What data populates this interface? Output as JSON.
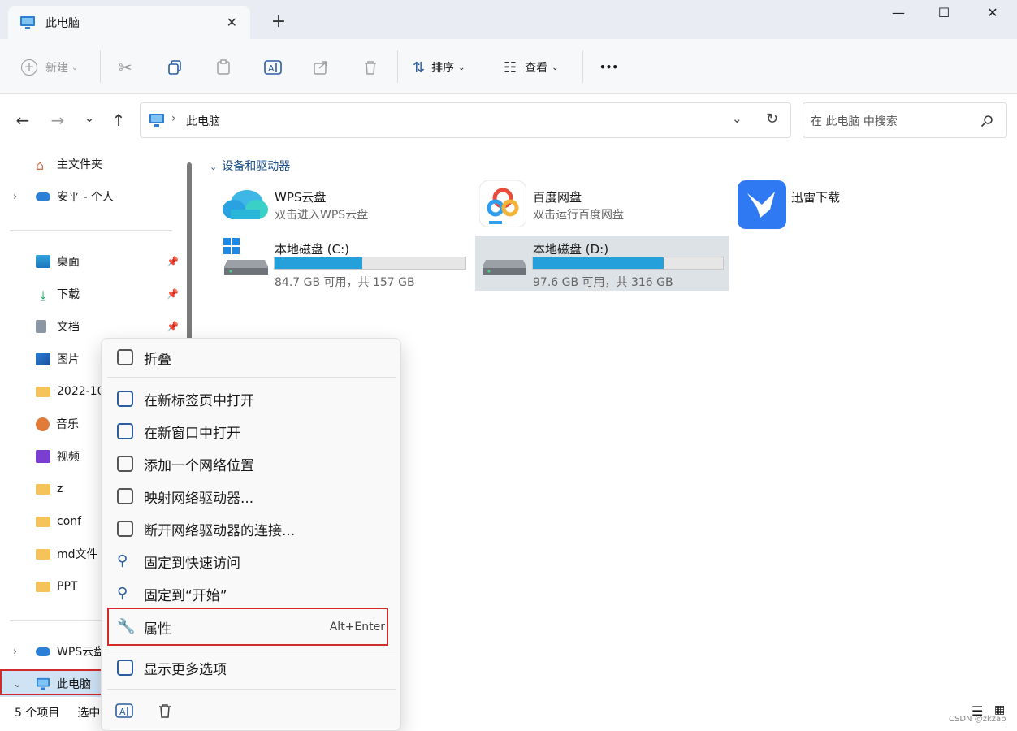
{
  "window": {
    "tab_title": "此电脑",
    "close": "✕",
    "new_tab": "+",
    "min": "—",
    "max": "☐",
    "close_win": "✕"
  },
  "toolbar": {
    "new_label": "新建",
    "sort_label": "排序",
    "view_label": "查看",
    "more": "•••"
  },
  "address": {
    "path": "此电脑",
    "search_placeholder": "在 此电脑 中搜索"
  },
  "sidebar": {
    "home": "主文件夹",
    "onedrive": "安平 - 个人",
    "pinned": [
      {
        "label": "桌面"
      },
      {
        "label": "下载"
      },
      {
        "label": "文档"
      },
      {
        "label": "图片"
      },
      {
        "label": "2022-10"
      },
      {
        "label": "音乐"
      },
      {
        "label": "视频"
      },
      {
        "label": "z"
      },
      {
        "label": "conf"
      },
      {
        "label": "md文件"
      },
      {
        "label": "PPT"
      }
    ],
    "wps": "WPS云盘",
    "thispc": "此电脑"
  },
  "main": {
    "group_label": "设备和驱动器",
    "items": [
      {
        "name": "WPS云盘",
        "sub": "双击进入WPS云盘"
      },
      {
        "name": "百度网盘",
        "sub": "双击运行百度网盘"
      },
      {
        "name": "迅雷下载",
        "sub": ""
      }
    ],
    "drives": [
      {
        "name": "本地磁盘 (C:)",
        "free": "84.7 GB 可用，共 157 GB",
        "used_pct": 46
      },
      {
        "name": "本地磁盘 (D:)",
        "free": "97.6 GB 可用，共 316 GB",
        "used_pct": 69
      }
    ]
  },
  "context_menu": {
    "collapse": "折叠",
    "items": [
      "在新标签页中打开",
      "在新窗口中打开",
      "添加一个网络位置",
      "映射网络驱动器...",
      "断开网络驱动器的连接...",
      "固定到快速访问",
      "固定到“开始”"
    ],
    "properties": "属性",
    "properties_shortcut": "Alt+Enter",
    "more": "显示更多选项"
  },
  "status": {
    "count": "5 个项目",
    "selected": "选中"
  },
  "watermark": "CSDN @zkzap",
  "colors": {
    "accent": "#26a0da",
    "highlight": "#d22b2b",
    "selected_bg": "#dde2e6"
  }
}
